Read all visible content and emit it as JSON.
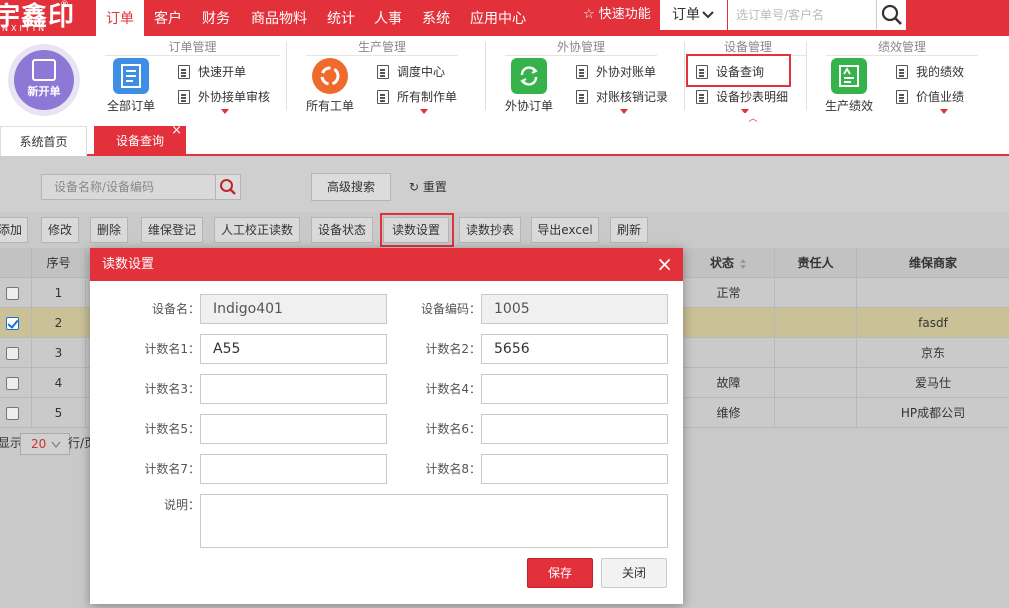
{
  "brand": {
    "logo_text": "宇鑫印",
    "logo_sub": "NXIYIN",
    "logo_mark": "®"
  },
  "nav": {
    "items": [
      {
        "label": "订单"
      },
      {
        "label": "客户"
      },
      {
        "label": "财务"
      },
      {
        "label": "商品物料"
      },
      {
        "label": "统计"
      },
      {
        "label": "人事"
      },
      {
        "label": "系统"
      },
      {
        "label": "应用中心"
      }
    ],
    "quick_label": "快速功能",
    "search_type": "订单",
    "search_placeholder": "选订单号/客户名"
  },
  "ribbon": {
    "new_order": "新开单",
    "groups": [
      {
        "title": "订单管理",
        "big": "全部订单",
        "small": [
          "快速开单",
          "外协接单审核"
        ]
      },
      {
        "title": "生产管理",
        "big": "所有工单",
        "small": [
          "调度中心",
          "所有制作单"
        ]
      },
      {
        "title": "外协管理",
        "big": "外协订单",
        "small": [
          "外协对账单",
          "对账核销记录"
        ]
      },
      {
        "title": "设备管理",
        "small": [
          "设备查询",
          "设备抄表明细"
        ]
      },
      {
        "title": "绩效管理",
        "big": "生产绩效",
        "small": [
          "我的绩效",
          "价值业绩"
        ]
      }
    ]
  },
  "tabs": [
    {
      "label": "系统首页"
    },
    {
      "label": "设备查询",
      "close": "×"
    }
  ],
  "filters": {
    "search_placeholder": "设备名称/设备编码",
    "advanced": "高级搜索",
    "reset": "重置"
  },
  "toolbar": [
    "添加",
    "修改",
    "删除",
    "维保登记",
    "人工校正读数",
    "设备状态",
    "读数设置",
    "读数抄表",
    "导出excel",
    "刷新"
  ],
  "table": {
    "headers": {
      "no": "序号",
      "status": "状态",
      "owner": "责任人",
      "vendor": "维保商家"
    },
    "rows": [
      {
        "no": "1",
        "status": "正常",
        "owner": "",
        "vendor": "",
        "checked": false
      },
      {
        "no": "2",
        "status": "",
        "owner": "",
        "vendor": "fasdf",
        "checked": true
      },
      {
        "no": "3",
        "status": "",
        "owner": "",
        "vendor": "京东",
        "checked": false
      },
      {
        "no": "4",
        "status": "故障",
        "owner": "",
        "vendor": "爱马仕",
        "checked": false
      },
      {
        "no": "5",
        "status": "维修",
        "owner": "",
        "vendor": "HP成都公司",
        "checked": false
      }
    ]
  },
  "pager": {
    "prefix": "显示",
    "page_size": "20",
    "suffix": "行/页"
  },
  "modal": {
    "title": "读数设置",
    "close": "×",
    "fields": {
      "device_name_label": "设备名：",
      "device_name": "Indigo401",
      "device_code_label": "设备编码：",
      "device_code": "1005",
      "c1_label": "计数名1：",
      "c1": "A55",
      "c2_label": "计数名2：",
      "c2": "5656",
      "c3_label": "计数名3：",
      "c3": "",
      "c4_label": "计数名4：",
      "c4": "",
      "c5_label": "计数名5：",
      "c5": "",
      "c6_label": "计数名6：",
      "c6": "",
      "c7_label": "计数名7：",
      "c7": "",
      "c8_label": "计数名8：",
      "c8": "",
      "desc_label": "说明：",
      "desc": ""
    },
    "save": "保存",
    "cancel": "关闭"
  },
  "colors": {
    "accent": "#e2313b",
    "selected_row": "#cbc196",
    "overlay": "#c9c9c9"
  }
}
